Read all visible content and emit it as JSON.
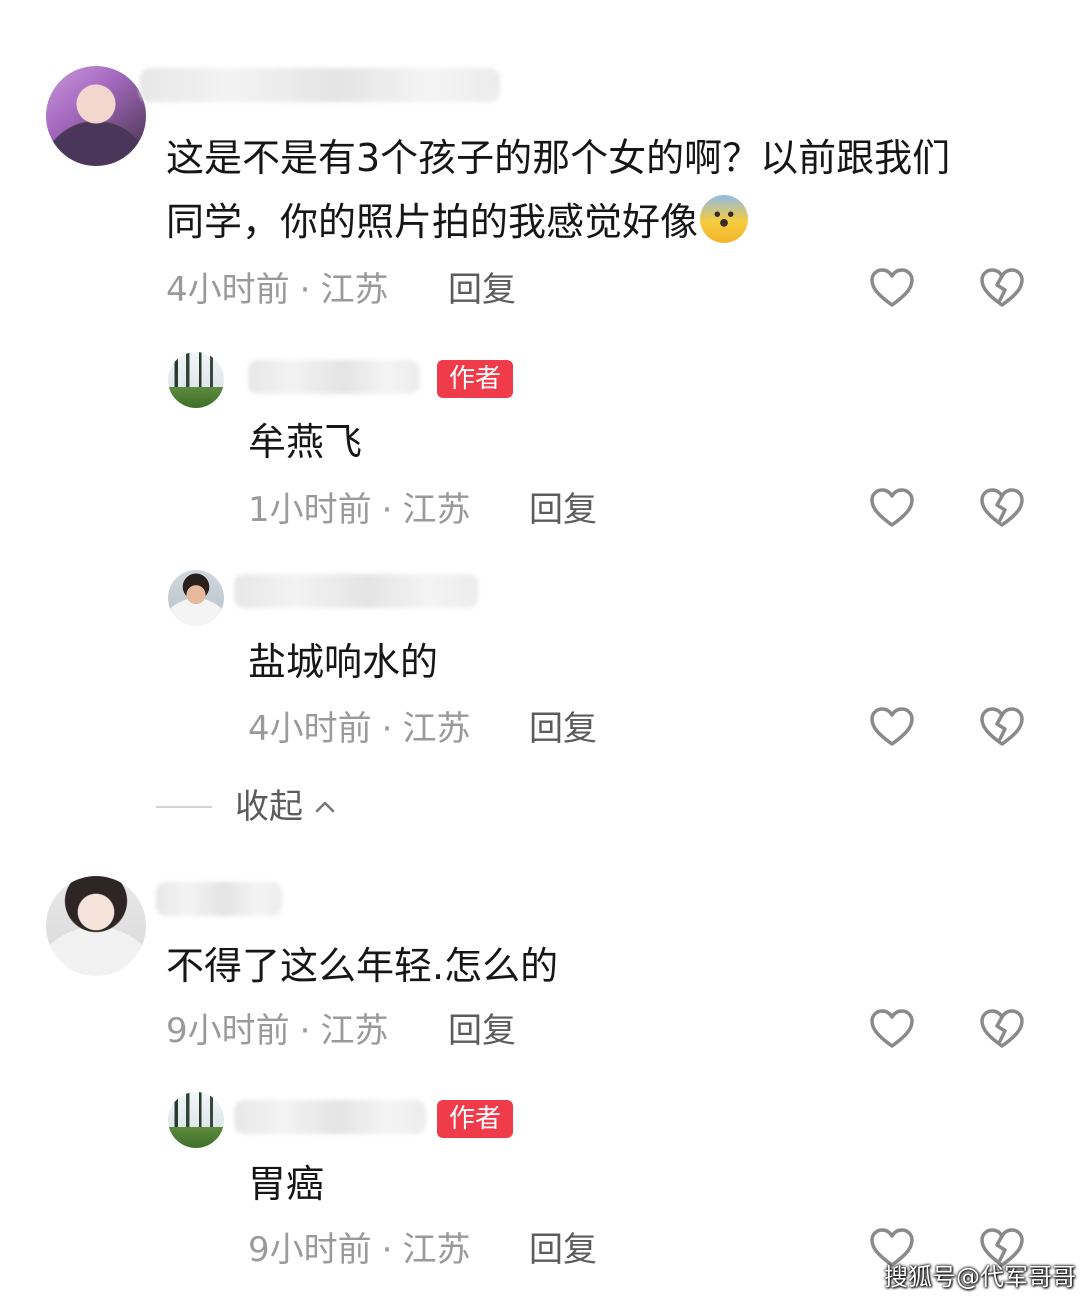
{
  "comments": [
    {
      "text": "这是不是有3个孩子的那个女的啊？以前跟我们",
      "text_line2": "同学，你的照片拍的我感觉好像",
      "time": "4小时前",
      "location": "江苏",
      "reply_label": "回复",
      "replies": [
        {
          "badge": "作者",
          "text": "牟燕飞",
          "time": "1小时前",
          "location": "江苏",
          "reply_label": "回复"
        },
        {
          "text": "盐城响水的",
          "time": "4小时前",
          "location": "江苏",
          "reply_label": "回复"
        }
      ],
      "collapse_label": "收起"
    },
    {
      "text": "不得了这么年轻.怎么的",
      "time": "9小时前",
      "location": "江苏",
      "reply_label": "回复",
      "replies": [
        {
          "badge": "作者",
          "text": "胃癌",
          "time": "9小时前",
          "location": "江苏",
          "reply_label": "回复"
        }
      ]
    }
  ],
  "meta_separator": "·",
  "watermark": "搜狐号@代军哥哥",
  "icons": {
    "like": "heart-outline-icon",
    "dislike": "broken-heart-icon",
    "collapse": "chevron-up-icon",
    "surprise_emoji": "screaming-face-emoji"
  },
  "colors": {
    "author_badge": "#f03c4a",
    "meta_text": "#9a9a9a",
    "body_text": "#161616"
  }
}
